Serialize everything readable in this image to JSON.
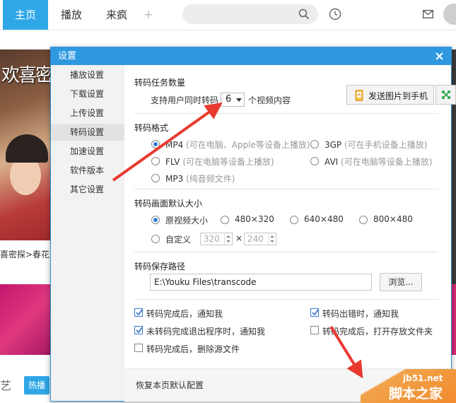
{
  "topbar": {
    "tabs": [
      "主页",
      "播放",
      "来疯"
    ],
    "add_tab": "+"
  },
  "background": {
    "banner_text": "欢喜密",
    "caption": "喜密探>春花",
    "yi": "艺",
    "hot_label": "热播"
  },
  "dialog": {
    "title": "设置",
    "sidebar": [
      "播放设置",
      "下载设置",
      "上传设置",
      "转码设置",
      "加速设置",
      "软件版本",
      "其它设置"
    ],
    "active_item": "转码设置",
    "task_count": {
      "title": "转码任务数量",
      "prefix": "支持用户同时转码",
      "value": "6",
      "suffix": "个视频内容"
    },
    "format": {
      "title": "转码格式",
      "options": [
        {
          "name": "MP4",
          "hint": "(可在电脑、Apple等设备上播放)"
        },
        {
          "name": "3GP",
          "hint": "(可在手机设备上播放)"
        },
        {
          "name": "FLV",
          "hint": "(可在电脑等设备上播放)"
        },
        {
          "name": "AVI",
          "hint": "(可在电脑等设备上播放)"
        },
        {
          "name": "MP3",
          "hint": "(纯音频文件)"
        }
      ],
      "selected": "MP4"
    },
    "size": {
      "title": "转码画面默认大小",
      "options": [
        "原视频大小",
        "480×320",
        "640×480",
        "800×480",
        "自定义"
      ],
      "selected": "原视频大小",
      "custom_width": "320",
      "times": "×",
      "custom_height": "240"
    },
    "path": {
      "title": "转码保存路径",
      "value": "E:\\Youku Files\\transcode",
      "browse": "浏览..."
    },
    "checks": [
      {
        "label": "转码完成后，通知我",
        "checked": true
      },
      {
        "label": "转码出错时，通知我",
        "checked": true
      },
      {
        "label": "未转码完成退出程序时，通知我",
        "checked": true
      },
      {
        "label": "转码完成后，打开存放文件夹",
        "checked": false
      },
      {
        "label": "转码完成后，删除源文件",
        "checked": false
      }
    ],
    "restore": "恢复本页默认配置"
  },
  "send_to_phone": "发送图片到手机",
  "watermark": {
    "url": "jb51.net",
    "name": "脚本之家"
  },
  "colors": {
    "accent": "#2e98e0",
    "arrow": "#e8392f"
  }
}
